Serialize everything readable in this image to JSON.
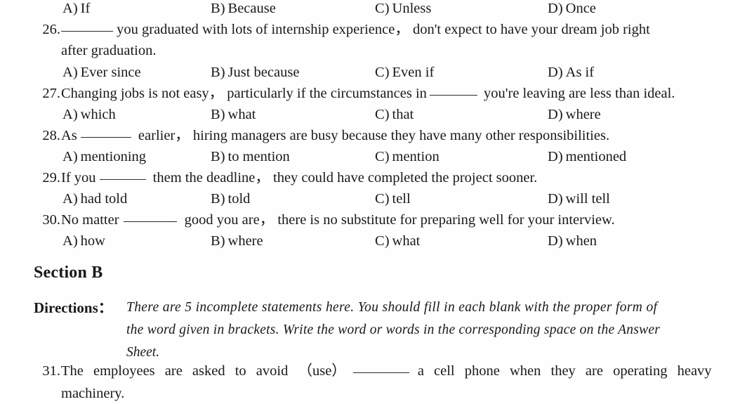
{
  "document": {
    "type": "exam-paper-scan",
    "background_color": "#fefefe",
    "text_color": "#191919"
  },
  "top_options": {
    "a": {
      "mark": "A",
      "paren": ")",
      "label": "If"
    },
    "b": {
      "mark": "B",
      "paren": ")",
      "label": "Because"
    },
    "c": {
      "mark": "C",
      "paren": ")",
      "label": "Unless"
    },
    "d": {
      "mark": "D",
      "paren": ")",
      "label": "Once"
    }
  },
  "questions": [
    {
      "number": "26.",
      "stem_part1": "",
      "stem_part2": " you graduated with lots of internship experience， don't expect to have your dream job right",
      "stem_line2": "after graduation.",
      "options": {
        "a": {
          "mark": "A",
          "paren": ")",
          "label": "Ever since"
        },
        "b": {
          "mark": "B",
          "paren": ")",
          "label": "Just because"
        },
        "c": {
          "mark": "C",
          "paren": ")",
          "label": "Even if"
        },
        "d": {
          "mark": "D",
          "paren": ")",
          "label": "As if"
        }
      }
    },
    {
      "number": "27.",
      "stem_part1": "Changing jobs is not easy， particularly if the circumstances in",
      "stem_part2": " you're leaving are less than ideal.",
      "options": {
        "a": {
          "mark": "A",
          "paren": ")",
          "label": "which"
        },
        "b": {
          "mark": "B",
          "paren": ")",
          "label": "what"
        },
        "c": {
          "mark": "C",
          "paren": ")",
          "label": "that"
        },
        "d": {
          "mark": "D",
          "paren": ")",
          "label": "where"
        }
      }
    },
    {
      "number": "28.",
      "stem_part1": "As",
      "stem_part2": " earlier， hiring managers are busy because they have many other responsibilities.",
      "options": {
        "a": {
          "mark": "A",
          "paren": ")",
          "label": "mentioning"
        },
        "b": {
          "mark": "B",
          "paren": ")",
          "label": "to mention"
        },
        "c": {
          "mark": "C",
          "paren": ")",
          "label": "mention"
        },
        "d": {
          "mark": "D",
          "paren": ")",
          "label": "mentioned"
        }
      }
    },
    {
      "number": "29.",
      "stem_part1": "If you",
      "stem_part2": " them the deadline， they could have completed the project sooner.",
      "options": {
        "a": {
          "mark": "A",
          "paren": ")",
          "label": "had told"
        },
        "b": {
          "mark": "B",
          "paren": ")",
          "label": "told"
        },
        "c": {
          "mark": "C",
          "paren": ")",
          "label": "tell"
        },
        "d": {
          "mark": "D",
          "paren": ")",
          "label": "will tell"
        }
      }
    },
    {
      "number": "30.",
      "stem_part1": "No matter",
      "stem_part2": " good you are， there is no substitute for preparing well for your interview.",
      "options": {
        "a": {
          "mark": "A",
          "paren": ")",
          "label": "how"
        },
        "b": {
          "mark": "B",
          "paren": ")",
          "label": "where"
        },
        "c": {
          "mark": "C",
          "paren": ")",
          "label": "what"
        },
        "d": {
          "mark": "D",
          "paren": ")",
          "label": "when"
        }
      }
    }
  ],
  "section_b": {
    "heading": "Section B",
    "directions_label": "Directions：",
    "directions_line1": "There are 5 incomplete statements here. You should fill in each blank with the proper form of",
    "directions_line2": "the word given in brackets. Write the word or words in the corresponding space on the Answer",
    "directions_line3": "Sheet.",
    "question_31": {
      "number": "31.",
      "stem_part1": "The employees are asked to avoid （use）",
      "stem_part2": "a cell phone when they are operating heavy",
      "stem_line2": "machinery."
    }
  }
}
